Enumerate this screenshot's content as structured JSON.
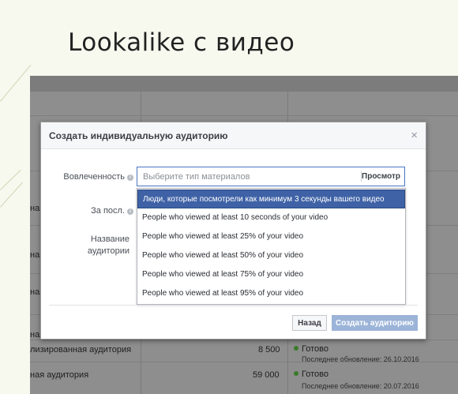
{
  "slide": {
    "title": "Lookalike с видео"
  },
  "background_table": {
    "rows": [
      {
        "name": "ная",
        "size": "",
        "status": "",
        "updated": ""
      },
      {
        "name": "ная",
        "size": "",
        "status": "",
        "updated": ""
      },
      {
        "name": "ная",
        "size": "",
        "status": "",
        "updated": ""
      },
      {
        "name": "ная",
        "size": "",
        "status": "",
        "updated": ""
      },
      {
        "name": "лизированная аудитория",
        "size": "8 500",
        "status": "Готово",
        "updated": "Последнее обновление: 26.10.2016"
      },
      {
        "name": "ная аудитория",
        "size": "59 000",
        "status": "Готово",
        "updated": "Последнее обновление: 20.07.2016"
      }
    ]
  },
  "dialog": {
    "title": "Создать индивидуальную аудиторию",
    "close_glyph": "×",
    "engagement_label": "Вовлеченность",
    "period_label": "За посл.",
    "audience_name_label_line1": "Название",
    "audience_name_label_line2": "аудитории",
    "select": {
      "placeholder": "Выберите тип материалов",
      "browse_label": "Просмотр"
    },
    "options": [
      "Люди, которые посмотрели как минимум 3 секунды вашего видео",
      "People who viewed at least 10 seconds of your video",
      "People who viewed at least 25% of your video",
      "People who viewed at least 50% of your video",
      "People who viewed at least 75% of your video",
      "People who viewed at least 95% of your video"
    ],
    "selected_index": 0,
    "back_button": "Назад",
    "create_button": "Создать аудиторию"
  },
  "colors": {
    "selected_option": "#3f62a6",
    "select_border": "#4a76c3",
    "create_button_disabled": "#9cb4d8",
    "status_ready": "#3a7a2a"
  }
}
